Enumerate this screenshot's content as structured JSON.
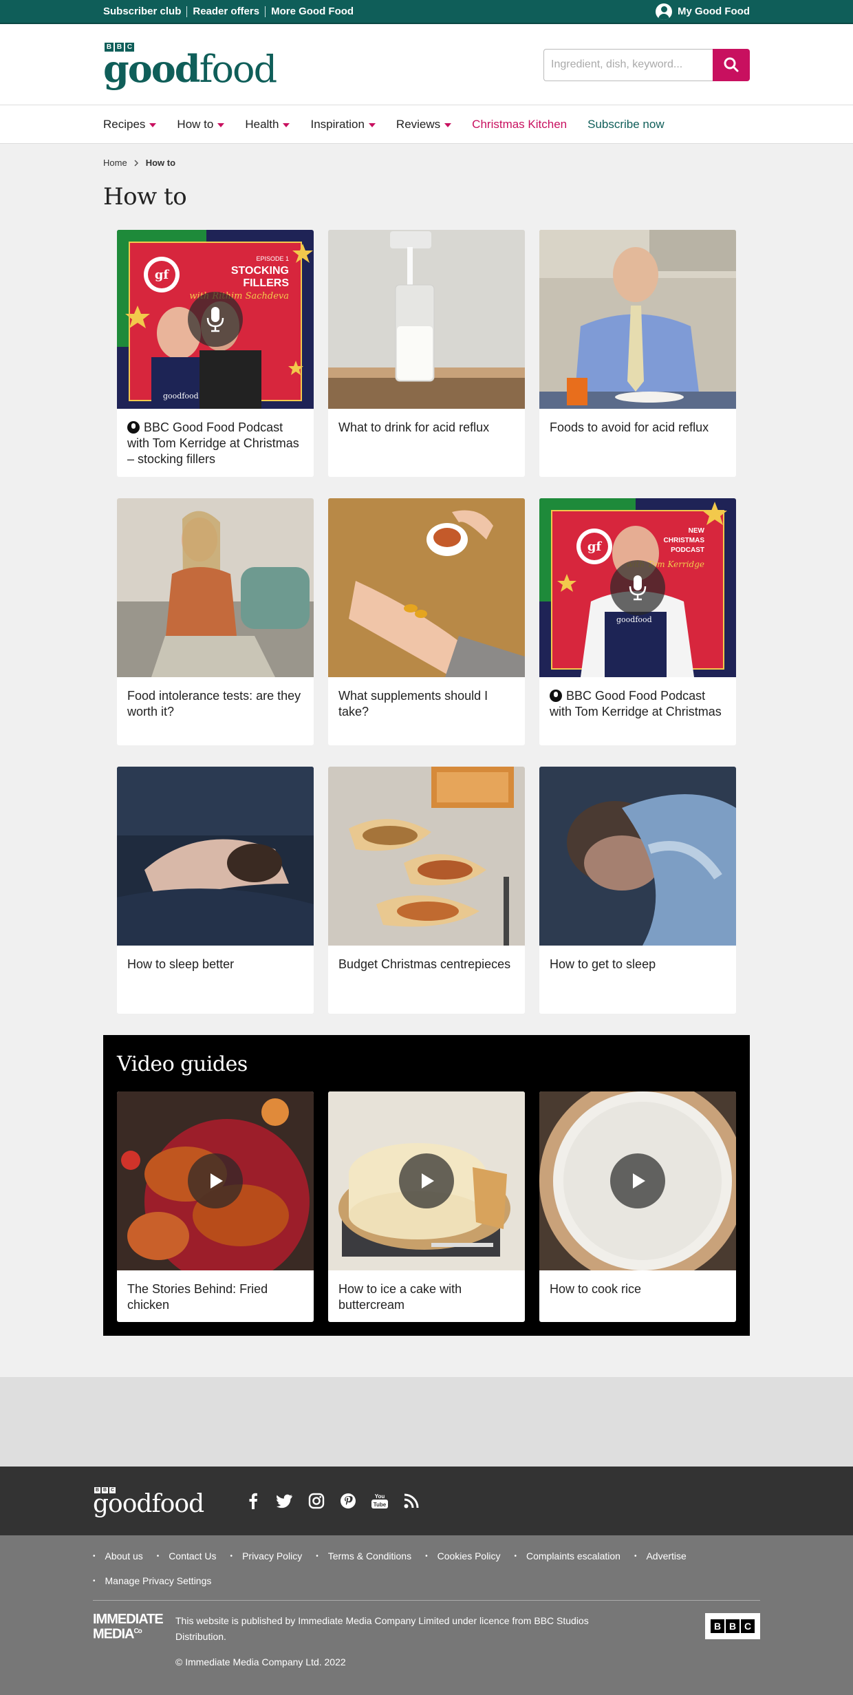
{
  "topbar": {
    "links": [
      "Subscriber club",
      "Reader offers",
      "More Good Food"
    ],
    "account_label": "My Good Food"
  },
  "header": {
    "logo_bbc": [
      "B",
      "B",
      "C"
    ],
    "logo_good": "good",
    "logo_food": "food",
    "search_placeholder": "Ingredient, dish, keyword..."
  },
  "nav": {
    "items": [
      {
        "label": "Recipes",
        "dropdown": true
      },
      {
        "label": "How to",
        "dropdown": true
      },
      {
        "label": "Health",
        "dropdown": true
      },
      {
        "label": "Inspiration",
        "dropdown": true
      },
      {
        "label": "Reviews",
        "dropdown": true
      }
    ],
    "christmas": "Christmas Kitchen",
    "subscribe": "Subscribe now"
  },
  "breadcrumb": {
    "home": "Home",
    "current": "How to"
  },
  "page_title": "How to",
  "cards": [
    {
      "title": "BBC Good Food Podcast with Tom Kerridge at Christmas – stocking fillers",
      "podcast": true,
      "art": {
        "ep": "EPISODE 1",
        "head1": "STOCKING",
        "head2": "FILLERS",
        "with": "with Rithim Sachdeva",
        "gf": "gf",
        "apron": "goodfood"
      }
    },
    {
      "title": "What to drink for acid reflux",
      "podcast": false
    },
    {
      "title": "Foods to avoid for acid reflux",
      "podcast": false
    },
    {
      "title": "Food intolerance tests: are they worth it?",
      "podcast": false
    },
    {
      "title": "What supplements should I take?",
      "podcast": false
    },
    {
      "title": "BBC Good Food Podcast with Tom Kerridge at Christmas",
      "podcast": true,
      "art": {
        "ep": "NEW",
        "head1": "CHRISTMAS",
        "head2": "PODCAST",
        "with": "with Tom Kerridge",
        "gf": "gf",
        "apron": "goodfood"
      }
    },
    {
      "title": "How to sleep better",
      "podcast": false
    },
    {
      "title": "Budget Christmas centrepieces",
      "podcast": false
    },
    {
      "title": "How to get to sleep",
      "podcast": false
    }
  ],
  "video": {
    "heading": "Video guides",
    "items": [
      {
        "title": "The Stories Behind: Fried chicken"
      },
      {
        "title": "How to ice a cake with buttercream"
      },
      {
        "title": "How to cook rice"
      }
    ]
  },
  "footer": {
    "logo_good": "good",
    "logo_food": "food",
    "socials": [
      "facebook-icon",
      "twitter-icon",
      "instagram-icon",
      "pinterest-icon",
      "youtube-icon",
      "rss-icon"
    ],
    "youtube_text": "You Tube",
    "links": [
      "About us",
      "Contact Us",
      "Privacy Policy",
      "Terms & Conditions",
      "Cookies Policy",
      "Complaints escalation",
      "Advertise",
      "Manage Privacy Settings"
    ],
    "immediate_line1": "IMMEDIATE",
    "immediate_line2": "MEDIA",
    "immediate_co": "Co",
    "publisher_text": "This website is published by Immediate Media Company Limited under licence from BBC Studios Distribution.",
    "copyright": "© Immediate Media Company Ltd. 2022",
    "bbc_letters": [
      "B",
      "B",
      "C"
    ]
  },
  "colors": {
    "brand_green": "#0f5e59",
    "accent_pink": "#c8105f"
  }
}
